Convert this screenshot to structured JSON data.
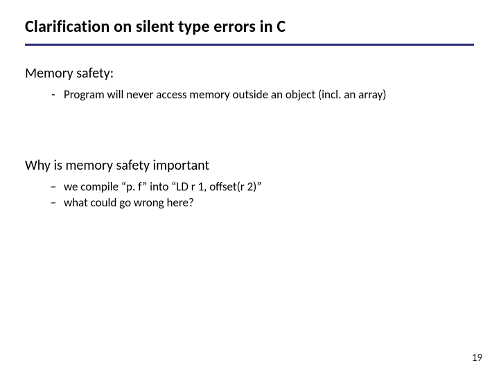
{
  "title": "Clarification on silent type errors in C",
  "sections": [
    {
      "heading": "Memory safety:",
      "bullets": [
        {
          "marker": "-",
          "text": "Program will never access memory outside an object (incl. an array)"
        }
      ]
    },
    {
      "heading": "Why is memory safety important",
      "bullets": [
        {
          "marker": "–",
          "text": "we compile “p. f” into “LD r 1, offset(r 2)”"
        },
        {
          "marker": "–",
          "text": "what could go wrong here?"
        }
      ]
    }
  ],
  "page_number": "19"
}
